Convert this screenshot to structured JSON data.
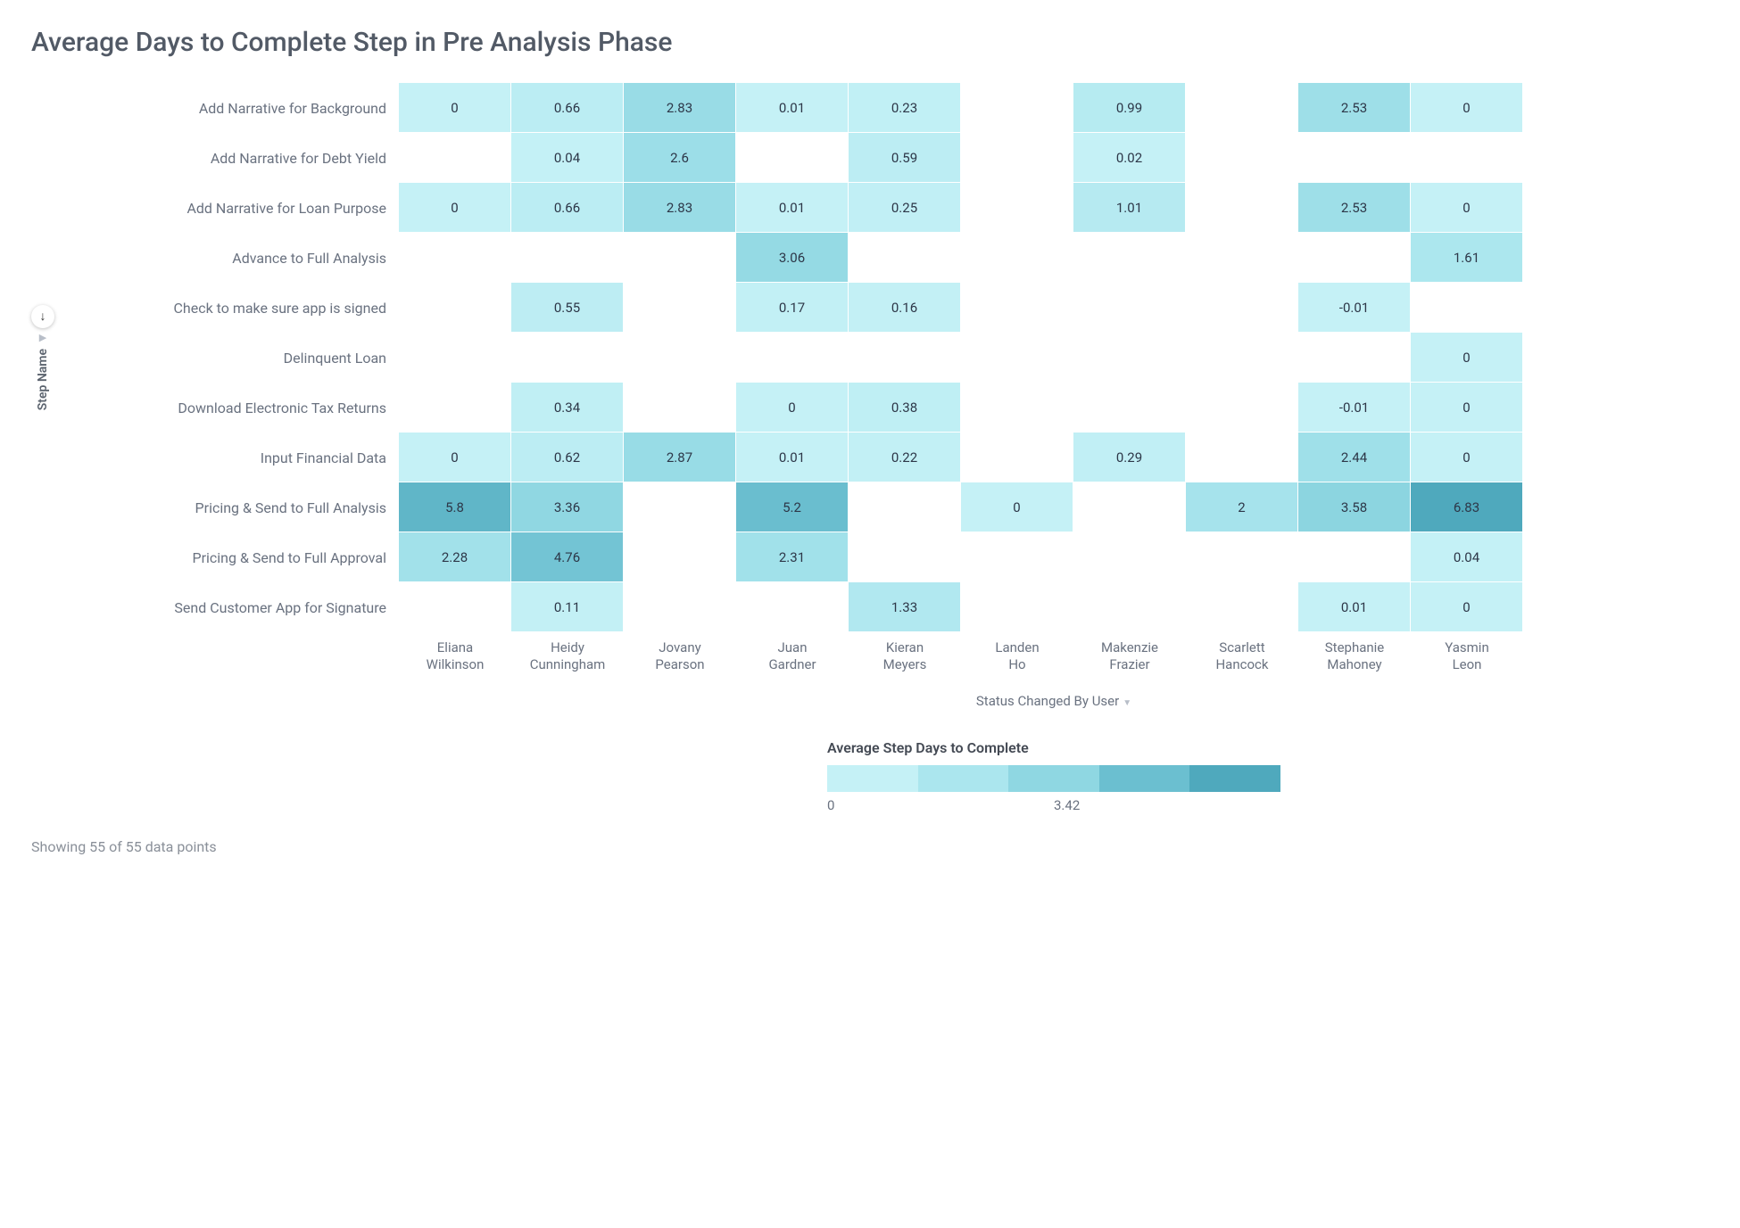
{
  "title": "Average Days to Complete Step in Pre Analysis Phase",
  "y_axis_label": "Step Name",
  "x_axis_label": "Status Changed By User",
  "legend_title": "Average Step Days to Complete",
  "footer_note": "Showing 55 of 55 data points",
  "legend_ticks": [
    "0",
    "3.42"
  ],
  "legend_colors": [
    "#c5f1f6",
    "#abe6ee",
    "#8fd7e2",
    "#6bbfd0",
    "#4fa9bd"
  ],
  "chart_data": {
    "type": "heatmap",
    "title": "Average Days to Complete Step in Pre Analysis Phase",
    "xlabel": "Status Changed By User",
    "ylabel": "Step Name",
    "x": [
      "Eliana Wilkinson",
      "Heidy Cunningham",
      "Jovany Pearson",
      "Juan Gardner",
      "Kieran Meyers",
      "Landen Ho",
      "Makenzie Frazier",
      "Scarlett Hancock",
      "Stephanie Mahoney",
      "Yasmin Leon"
    ],
    "y": [
      "Add Narrative for Background",
      "Add Narrative for Debt Yield",
      "Add Narrative for Loan Purpose",
      "Advance to Full Analysis",
      "Check to make sure app is signed",
      "Delinquent Loan",
      "Download Electronic Tax Returns",
      "Input Financial Data",
      "Pricing & Send to Full Analysis",
      "Pricing & Send to Full Approval",
      "Send Customer App for Signature"
    ],
    "values": [
      [
        0,
        0.66,
        2.83,
        0.01,
        0.23,
        null,
        0.99,
        null,
        2.53,
        0
      ],
      [
        null,
        0.04,
        2.6,
        null,
        0.59,
        null,
        0.02,
        null,
        null,
        null
      ],
      [
        0,
        0.66,
        2.83,
        0.01,
        0.25,
        null,
        1.01,
        null,
        2.53,
        0
      ],
      [
        null,
        null,
        null,
        3.06,
        null,
        null,
        null,
        null,
        null,
        1.61
      ],
      [
        null,
        0.55,
        null,
        0.17,
        0.16,
        null,
        null,
        null,
        -0.01,
        null
      ],
      [
        null,
        null,
        null,
        null,
        null,
        null,
        null,
        null,
        null,
        0
      ],
      [
        null,
        0.34,
        null,
        0,
        0.38,
        null,
        null,
        null,
        -0.01,
        0
      ],
      [
        0,
        0.62,
        2.87,
        0.01,
        0.22,
        null,
        0.29,
        null,
        2.44,
        0
      ],
      [
        5.8,
        3.36,
        null,
        5.2,
        null,
        0,
        null,
        2,
        3.58,
        6.83
      ],
      [
        2.28,
        4.76,
        null,
        2.31,
        null,
        null,
        null,
        null,
        null,
        0.04
      ],
      [
        null,
        0.11,
        null,
        null,
        1.33,
        null,
        null,
        null,
        0.01,
        0
      ]
    ],
    "value_range": [
      0,
      6.83
    ],
    "legend_mid": 3.42
  }
}
